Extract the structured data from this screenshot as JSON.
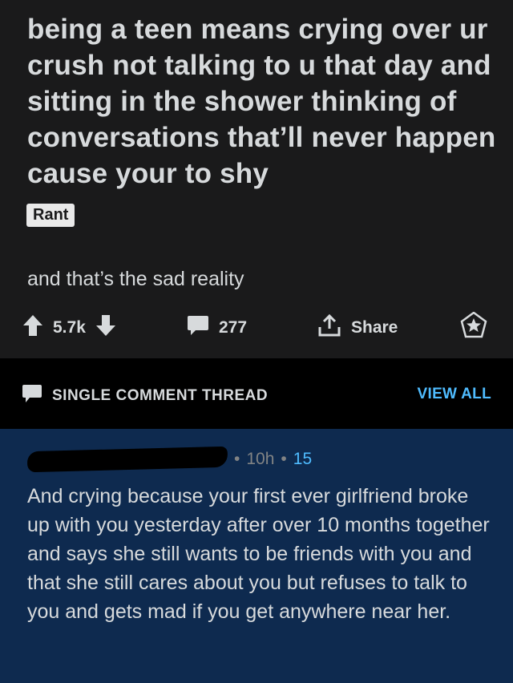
{
  "post": {
    "title": "being a teen means crying over ur crush not talking to u that day and sitting in the shower thinking of conversations that’ll never happen cause your to shy",
    "flair": "Rant",
    "body": "and that’s the sad reality",
    "votes": "5.7k",
    "comments": "277",
    "share_label": "Share"
  },
  "thread": {
    "label": "SINGLE COMMENT THREAD",
    "view_all": "VIEW ALL"
  },
  "comment": {
    "age": "10h",
    "score": "15",
    "separator": "•",
    "body": "And crying because your first ever girlfriend broke up with you yesterday after over 10 months together and says she still wants to be friends with you and that she still cares about you but refuses to talk to you and gets mad if you get anywhere near her."
  },
  "icons": {
    "upvote": "arrow-up-icon",
    "downvote": "arrow-down-icon",
    "comments": "speech-bubble-icon",
    "share": "share-icon",
    "award": "award-icon",
    "thread": "speech-bubble-icon"
  },
  "colors": {
    "post_bg": "#1a1a1b",
    "comment_bg": "#0e2a4f",
    "accent": "#4fbcff",
    "text": "#d7dadc"
  }
}
